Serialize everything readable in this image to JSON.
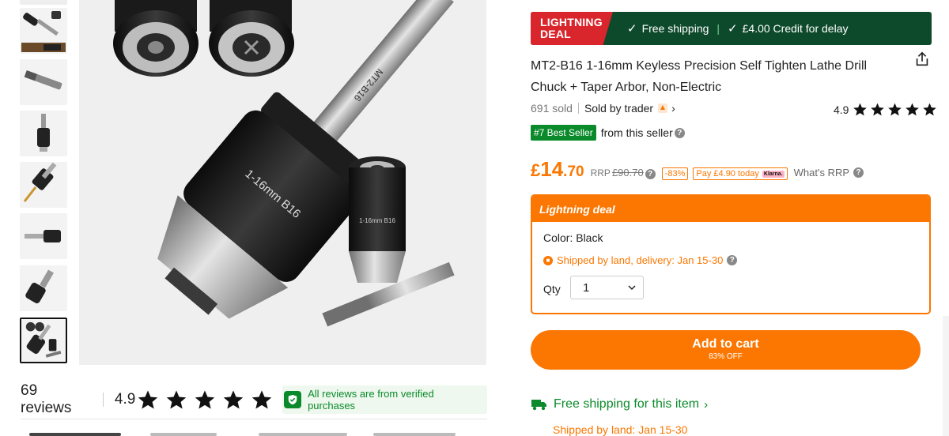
{
  "banner": {
    "badge_line1": "LIGHTNING",
    "badge_line2": "DEAL",
    "free_shipping": "Free shipping",
    "separator": "|",
    "credit": "£4.00 Credit for delay",
    "colors": {
      "red": "#d9262c",
      "green": "#0d4a2c"
    }
  },
  "product": {
    "title": "MT2-B16 1-16mm Keyless Precision Self Tighten Lathe Drill Chuck + Taper Arbor, Non-Electric",
    "sold": "691 sold",
    "sold_by": "Sold by trader",
    "rating": "4.9",
    "stars": 5,
    "best_seller": "#7 Best Seller",
    "from_seller": "from this seller"
  },
  "price": {
    "currency": "£",
    "integer": "14",
    "decimal": ".70",
    "rrp_label": "RRP",
    "rrp_value": "£90.70",
    "discount": "-83%",
    "klarna": "Pay £4.90 today",
    "klarna_mark": "Klarna.",
    "whats_rrp": "What's RRP",
    "accent": "#fb7701"
  },
  "deal": {
    "header": "Lightning deal",
    "color_label": "Color: Black",
    "shipping": "Shipped by land, delivery: Jan 15-30",
    "qty_label": "Qty",
    "qty_value": "1"
  },
  "cart": {
    "label": "Add to cart",
    "sub": "83% OFF"
  },
  "shipping": {
    "free": "Free shipping for this item",
    "sub": "Shipped by land: Jan 15-30"
  },
  "reviews": {
    "count": "69 reviews",
    "rating": "4.9",
    "stars": 5,
    "verified": "All reviews are from verified purchases"
  },
  "gallery": {
    "thumbnail_count": 8,
    "active_index": 7,
    "main_image_labels": [
      "MT2-B16",
      "1-16mm B16",
      "1-16mm B16"
    ]
  }
}
